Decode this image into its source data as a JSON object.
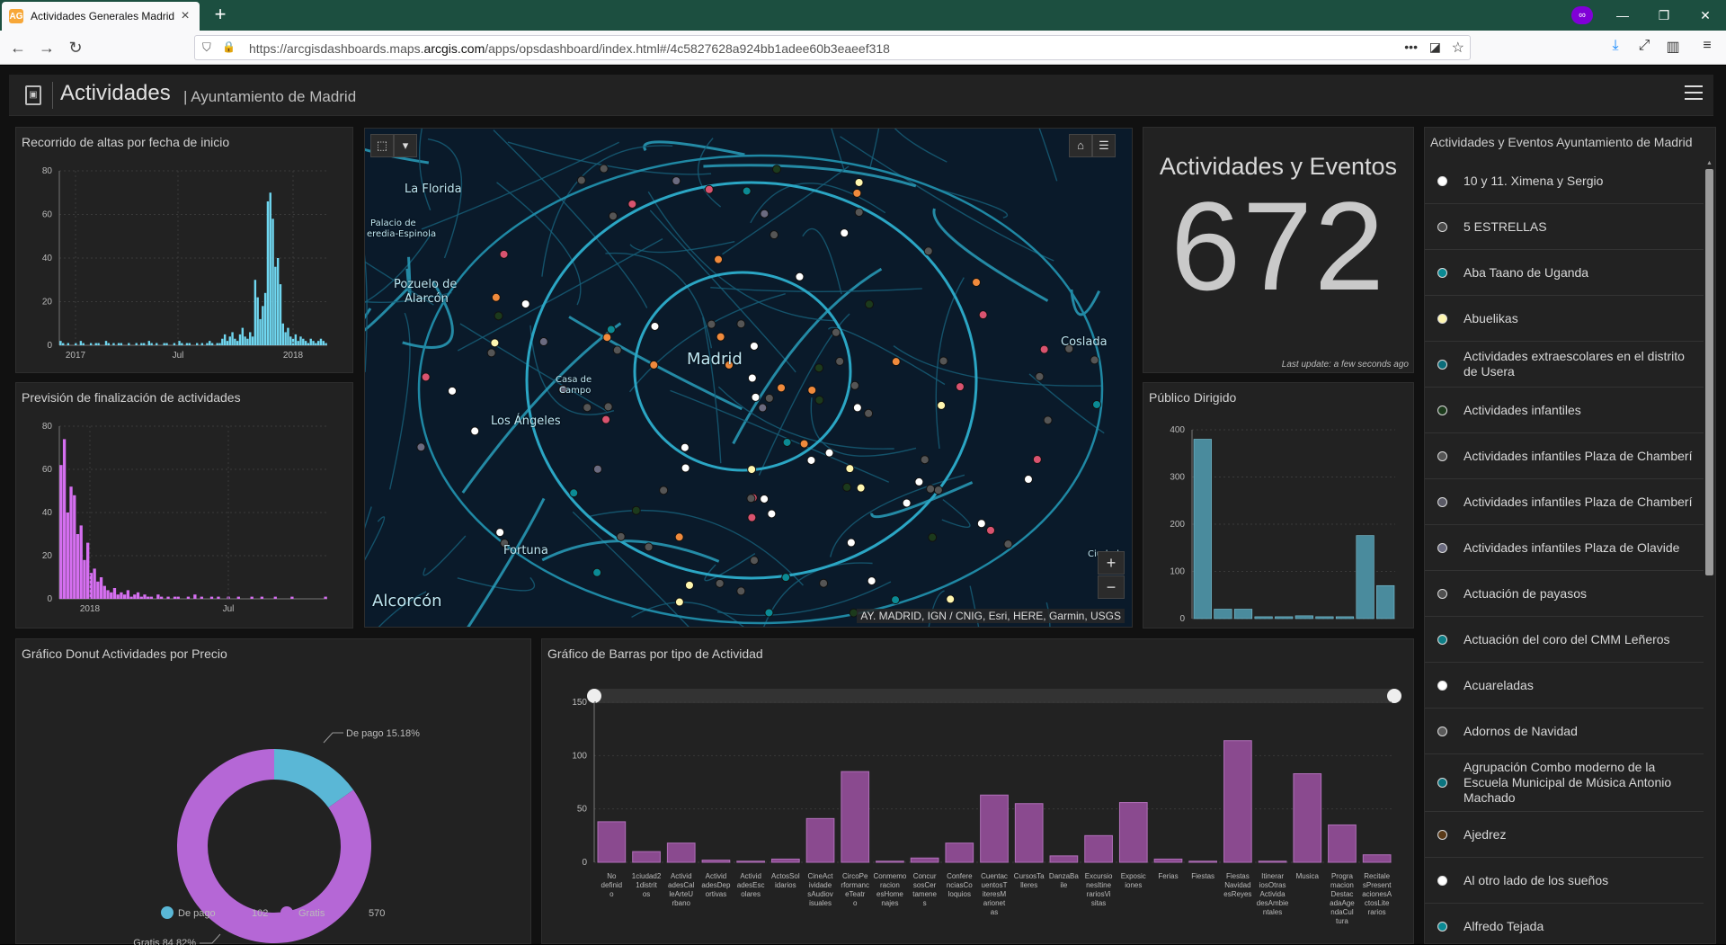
{
  "browser": {
    "tab_title": "Actividades Generales Madrid",
    "favicon_text": "AG",
    "url_prefix": "https://arcgisdashboards.maps.",
    "url_domain": "arcgis.com",
    "url_suffix": "/apps/opsdashboard/index.html#/4c5827628a924bb1adee60b3eaeef318"
  },
  "header": {
    "title": "Actividades",
    "subtitle": "| Ayuntamiento de Madrid"
  },
  "chart_altas": {
    "title": "Recorrido de altas por fecha de inicio",
    "color": "#6fd6ef",
    "chart_data": {
      "type": "bar",
      "x_ticks": [
        "2017",
        "Jul",
        "2018"
      ],
      "y_ticks": [
        0,
        20,
        40,
        60,
        80
      ],
      "ylim": [
        0,
        80
      ],
      "values": [
        2,
        1,
        0,
        1,
        0,
        0,
        1,
        0,
        2,
        1,
        0,
        0,
        1,
        0,
        1,
        1,
        0,
        0,
        2,
        1,
        0,
        1,
        0,
        1,
        1,
        0,
        0,
        1,
        0,
        0,
        1,
        0,
        1,
        1,
        0,
        2,
        1,
        0,
        1,
        0,
        0,
        1,
        1,
        0,
        0,
        1,
        0,
        2,
        1,
        0,
        1,
        1,
        0,
        0,
        1,
        0,
        1,
        0,
        1,
        2,
        1,
        0,
        1,
        1,
        3,
        5,
        2,
        4,
        6,
        3,
        2,
        5,
        8,
        4,
        3,
        6,
        4,
        30,
        22,
        12,
        18,
        24,
        66,
        70,
        58,
        36,
        40,
        28,
        10,
        6,
        8,
        4,
        3,
        5,
        2,
        4,
        3,
        2,
        1,
        3,
        2,
        1,
        2,
        3,
        2,
        1
      ]
    }
  },
  "chart_prevision": {
    "title": "Previsión de finalización de actividades",
    "color": "#d56ff0",
    "chart_data": {
      "type": "bar",
      "x_ticks": [
        "2018",
        "Jul"
      ],
      "y_ticks": [
        0,
        20,
        40,
        60,
        80
      ],
      "ylim": [
        0,
        80
      ],
      "values": [
        62,
        74,
        40,
        52,
        48,
        30,
        34,
        18,
        26,
        12,
        14,
        8,
        10,
        6,
        4,
        3,
        5,
        2,
        3,
        2,
        4,
        1,
        2,
        3,
        1,
        2,
        1,
        1,
        0,
        2,
        1,
        0,
        1,
        0,
        1,
        1,
        0,
        0,
        1,
        0,
        2,
        0,
        1,
        0,
        0,
        1,
        0,
        1,
        0,
        0,
        1,
        0,
        0,
        1,
        0,
        0,
        0,
        1,
        0,
        0,
        1,
        0,
        0,
        0,
        1,
        0,
        0,
        0,
        0,
        1,
        0,
        0,
        0,
        0,
        0,
        0,
        0,
        0,
        0,
        1
      ]
    }
  },
  "indicator": {
    "title": "Actividades y Eventos",
    "value": "672",
    "last_update": "Last update: a few seconds ago"
  },
  "chart_publico": {
    "title": "Público Dirigido",
    "color": "#4a8b9d",
    "chart_data": {
      "type": "bar",
      "y_ticks": [
        0,
        100,
        200,
        300,
        400
      ],
      "ylim": [
        0,
        400
      ],
      "values": [
        380,
        20,
        20,
        4,
        4,
        6,
        4,
        4,
        176,
        70
      ]
    }
  },
  "list": {
    "title": "Actividades y Eventos Ayuntamiento de Madrid",
    "items": [
      {
        "label": "10 y 11. Ximena y Sergio",
        "color": "#ffffff"
      },
      {
        "label": "5 ESTRELLAS",
        "color": "#4a4a4a"
      },
      {
        "label": "Aba Taano de Uganda",
        "color": "#0b8a94"
      },
      {
        "label": "Abuelikas",
        "color": "#fff7b0"
      },
      {
        "label": "Actividades extraescolares en el distrito de Usera",
        "color": "#0b6d7a"
      },
      {
        "label": "Actividades infantiles",
        "color": "#1c3a1c"
      },
      {
        "label": "Actividades infantiles Plaza de Chamberí",
        "color": "#555555"
      },
      {
        "label": "Actividades infantiles Plaza de Chamberí",
        "color": "#5a5a66"
      },
      {
        "label": "Actividades infantiles Plaza de Olavide",
        "color": "#6b6b80"
      },
      {
        "label": "Actuación de payasos",
        "color": "#505050"
      },
      {
        "label": "Actuación del coro del CMM Leñeros",
        "color": "#0e7e86"
      },
      {
        "label": "Acuareladas",
        "color": "#ffffff"
      },
      {
        "label": "Adornos de Navidad",
        "color": "#5a5a5a"
      },
      {
        "label": "Agrupación Combo moderno de la Escuela Municipal de Música Antonio Machado",
        "color": "#0b7580"
      },
      {
        "label": "Ajedrez",
        "color": "#5a3a18"
      },
      {
        "label": "Al otro lado de los sueños",
        "color": "#ffffff"
      },
      {
        "label": "Alfredo Tejada",
        "color": "#0b8a94"
      }
    ]
  },
  "map": {
    "attribution": "AY. MADRID, IGN / CNIG, Esri, HERE, Garmin, USGS",
    "places": [
      {
        "name": "La Florida"
      },
      {
        "name": "Palacio de"
      },
      {
        "name": "eredia-Espinola"
      },
      {
        "name": "Pozuelo de"
      },
      {
        "name": "Alarcón"
      },
      {
        "name": "Madrid"
      },
      {
        "name": "Casa de"
      },
      {
        "name": "Campo"
      },
      {
        "name": "Los Ángeles"
      },
      {
        "name": "Coslada"
      },
      {
        "name": "Fortuna"
      },
      {
        "name": "Alcorcón"
      },
      {
        "name": "Ciudad"
      }
    ]
  },
  "donut": {
    "title": "Gráfico Donut Actividades por Precio",
    "chart_data": {
      "type": "pie",
      "slices": [
        {
          "name": "De pago",
          "value": 102,
          "percent": "15.18%",
          "color": "#5ab7d6"
        },
        {
          "name": "Gratis",
          "value": 570,
          "percent": "84.82%",
          "color": "#b567d6"
        }
      ]
    },
    "label_pago": "De pago 15.18%",
    "label_gratis": "Gratis 84.82%",
    "legend": [
      {
        "name": "De pago",
        "value": "102"
      },
      {
        "name": "Gratis",
        "value": "570"
      }
    ]
  },
  "barras": {
    "title": "Gráfico de Barras por tipo de Actividad",
    "color": "#8a4a8f",
    "stroke": "#b06fb8",
    "chart_data": {
      "type": "bar",
      "ylim": [
        0,
        150
      ],
      "y_ticks": [
        0,
        50,
        100,
        150
      ],
      "categories": [
        [
          "No",
          "definid",
          "o"
        ],
        [
          "1ciudad2",
          "1distrit",
          "os"
        ],
        [
          "Activid",
          "adesCal",
          "leArteU",
          "rbano"
        ],
        [
          "Activid",
          "adesDep",
          "ortivas"
        ],
        [
          "Activid",
          "adesEsc",
          "olares"
        ],
        [
          "ActosSol",
          "idarios"
        ],
        [
          "CineAct",
          "ividade",
          "sAudiov",
          "isuales"
        ],
        [
          "CircoPe",
          "rformanc",
          "eTeatr",
          "o"
        ],
        [
          "Conmemo",
          "racion",
          "esHome",
          "najes"
        ],
        [
          "Concur",
          "sosCer",
          "tamene",
          "s"
        ],
        [
          "Confere",
          "nciasCo",
          "loquios"
        ],
        [
          "Cuentac",
          "uentosT",
          "iteresM",
          "arionet",
          "as"
        ],
        [
          "CursosTa",
          "lleres"
        ],
        [
          "DanzaBa",
          "ile"
        ],
        [
          "Excursio",
          "nesItine",
          "rariosVi",
          "sitas"
        ],
        [
          "Exposic",
          "iones"
        ],
        [
          "Ferias"
        ],
        [
          "Fiestas"
        ],
        [
          "Fiestas",
          "Navidad",
          "esReyes"
        ],
        [
          "Itinerar",
          "iosOtras",
          "Activida",
          "desAmbie",
          "ntales"
        ],
        [
          "Musica"
        ],
        [
          "Progra",
          "macion",
          "Destac",
          "adaAge",
          "ndaCul",
          "tura"
        ],
        [
          "Recitale",
          "sPresent",
          "acionesA",
          "ctosLite",
          "rarios"
        ]
      ],
      "values": [
        38,
        10,
        18,
        2,
        1,
        3,
        41,
        85,
        1,
        4,
        18,
        63,
        55,
        6,
        25,
        56,
        3,
        1,
        114,
        1,
        83,
        35,
        7
      ]
    }
  }
}
